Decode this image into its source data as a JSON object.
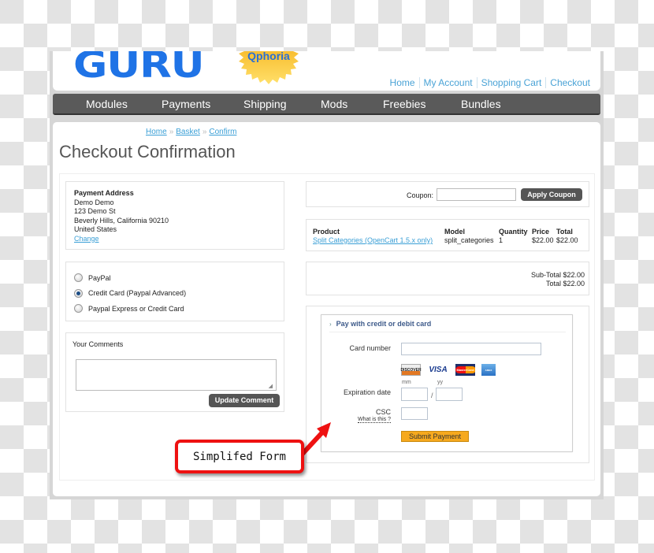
{
  "header": {
    "logo_text": "GURU",
    "badge_text": "Qphoria",
    "toplinks": [
      "Home",
      "My Account",
      "Shopping Cart",
      "Checkout"
    ]
  },
  "nav": {
    "items": [
      "Modules",
      "Payments",
      "Shipping",
      "Mods",
      "Freebies",
      "Bundles"
    ]
  },
  "breadcrumb": [
    "Home",
    "Basket",
    "Confirm"
  ],
  "breadcrumb_sep": "»",
  "page_title": "Checkout Confirmation",
  "payment_address": {
    "heading": "Payment Address",
    "lines": [
      "Demo Demo",
      "123 Demo St",
      "Beverly Hills, California 90210",
      "United States"
    ],
    "change_link": "Change"
  },
  "payment_methods": [
    {
      "label": "PayPal",
      "selected": false
    },
    {
      "label": "Credit Card (Paypal Advanced)",
      "selected": true
    },
    {
      "label": "Paypal Express or Credit Card",
      "selected": false
    }
  ],
  "comments": {
    "label": "Your Comments",
    "value": "",
    "button": "Update Comment"
  },
  "coupon": {
    "label": "Coupon:",
    "value": "",
    "button": "Apply Coupon"
  },
  "order": {
    "headers": [
      "Product",
      "Model",
      "Quantity",
      "Price",
      "Total"
    ],
    "rows": [
      {
        "product": "Split Categories (OpenCart 1.5.x only)",
        "model": "split_categories",
        "quantity": "1",
        "price": "$22.00",
        "total": "$22.00"
      }
    ]
  },
  "totals": {
    "subtotal": "Sub-Total $22.00",
    "total": "Total $22.00"
  },
  "card_form": {
    "heading": "Pay with credit or debit card",
    "card_number_label": "Card number",
    "card_number_value": "",
    "card_logos": [
      "DISCOVER",
      "VISA",
      "MasterCard",
      "AMEX"
    ],
    "expiration_label": "Expiration date",
    "mm_label": "mm",
    "yy_label": "yy",
    "exp_separator": "/",
    "csc_label": "CSC",
    "csc_help": "What is this ?",
    "submit": "Submit Payment"
  },
  "callout": {
    "text": "Simplifed Form",
    "color": "#ee1111"
  }
}
